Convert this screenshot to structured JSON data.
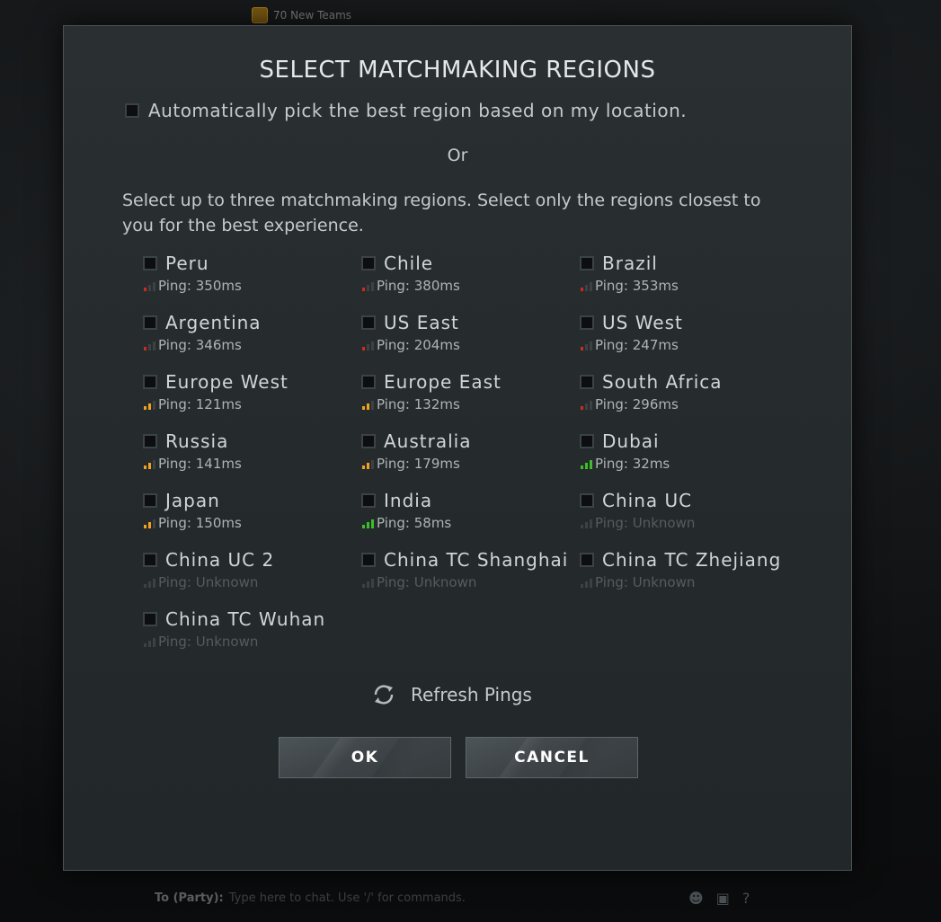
{
  "background": {
    "badge_text": "70 New Teams",
    "chat_prefix": "To (Party):",
    "chat_placeholder": "Type here to chat. Use '/' for commands."
  },
  "dialog": {
    "title": "SELECT MATCHMAKING REGIONS",
    "auto_pick_label": "Automatically pick the best region based on my location.",
    "auto_pick_checked": false,
    "or_text": "Or",
    "instructions": "Select up to three matchmaking regions. Select only the regions closest to you for the best experience.",
    "regions": [
      {
        "name": "Peru",
        "ping": "Ping: 350ms",
        "quality": "red"
      },
      {
        "name": "Chile",
        "ping": "Ping: 380ms",
        "quality": "red"
      },
      {
        "name": "Brazil",
        "ping": "Ping: 353ms",
        "quality": "red"
      },
      {
        "name": "Argentina",
        "ping": "Ping: 346ms",
        "quality": "red"
      },
      {
        "name": "US East",
        "ping": "Ping: 204ms",
        "quality": "red"
      },
      {
        "name": "US West",
        "ping": "Ping: 247ms",
        "quality": "red"
      },
      {
        "name": "Europe West",
        "ping": "Ping: 121ms",
        "quality": "orange"
      },
      {
        "name": "Europe East",
        "ping": "Ping: 132ms",
        "quality": "orange"
      },
      {
        "name": "South Africa",
        "ping": "Ping: 296ms",
        "quality": "red"
      },
      {
        "name": "Russia",
        "ping": "Ping: 141ms",
        "quality": "orange"
      },
      {
        "name": "Australia",
        "ping": "Ping: 179ms",
        "quality": "orange"
      },
      {
        "name": "Dubai",
        "ping": "Ping: 32ms",
        "quality": "green"
      },
      {
        "name": "Japan",
        "ping": "Ping: 150ms",
        "quality": "orange"
      },
      {
        "name": "India",
        "ping": "Ping: 58ms",
        "quality": "green"
      },
      {
        "name": "China UC",
        "ping": "Ping: Unknown",
        "quality": "unknown"
      },
      {
        "name": "China UC 2",
        "ping": "Ping: Unknown",
        "quality": "unknown"
      },
      {
        "name": "China TC Shanghai",
        "ping": "Ping: Unknown",
        "quality": "unknown"
      },
      {
        "name": "China TC Zhejiang",
        "ping": "Ping: Unknown",
        "quality": "unknown"
      },
      {
        "name": "China TC Wuhan",
        "ping": "Ping: Unknown",
        "quality": "unknown"
      }
    ],
    "refresh_label": "Refresh Pings",
    "ok_label": "OK",
    "cancel_label": "CANCEL"
  },
  "colors": {
    "ping_red": "#d02a1e",
    "ping_orange": "#f2a01d",
    "ping_green": "#3ebd2b",
    "ping_unknown": "#3c4244"
  }
}
